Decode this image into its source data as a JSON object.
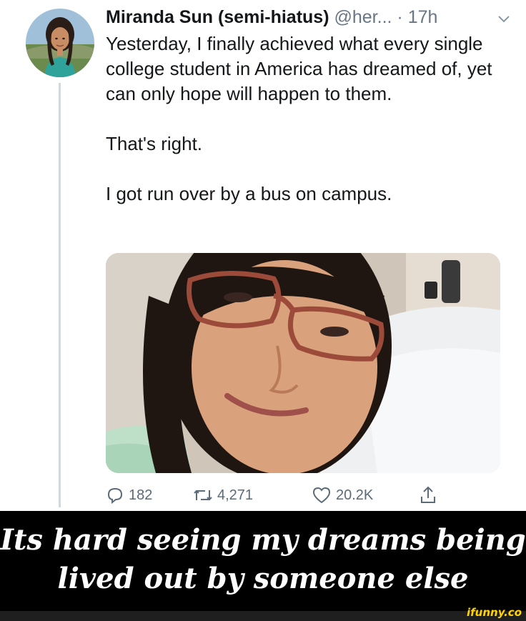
{
  "tweet": {
    "display_name": "Miranda Sun (semi-hiatus)",
    "handle": "@her...",
    "separator": " · ",
    "time": "17h",
    "paragraphs": [
      "Yesterday, I finally achieved what every single college student in America has dreamed of, yet can only hope will happen to them.",
      "That's right.",
      "I got run over by a bus on campus."
    ],
    "avatar_icon": "profile-photo",
    "media_icon": "selfie-photo",
    "actions": {
      "replies": "182",
      "retweets": "4,271",
      "likes": "20.2K"
    }
  },
  "caption": {
    "line1": "Its hard seeing my dreams being",
    "line2": "lived out by someone else"
  },
  "watermark": "ifunny.co",
  "colors": {
    "name": "#14171a",
    "secondary": "#687684",
    "thread_line": "#cfd9de",
    "caption_bg": "#000000",
    "caption_text": "#ffffff",
    "watermark": "#ffd400"
  }
}
